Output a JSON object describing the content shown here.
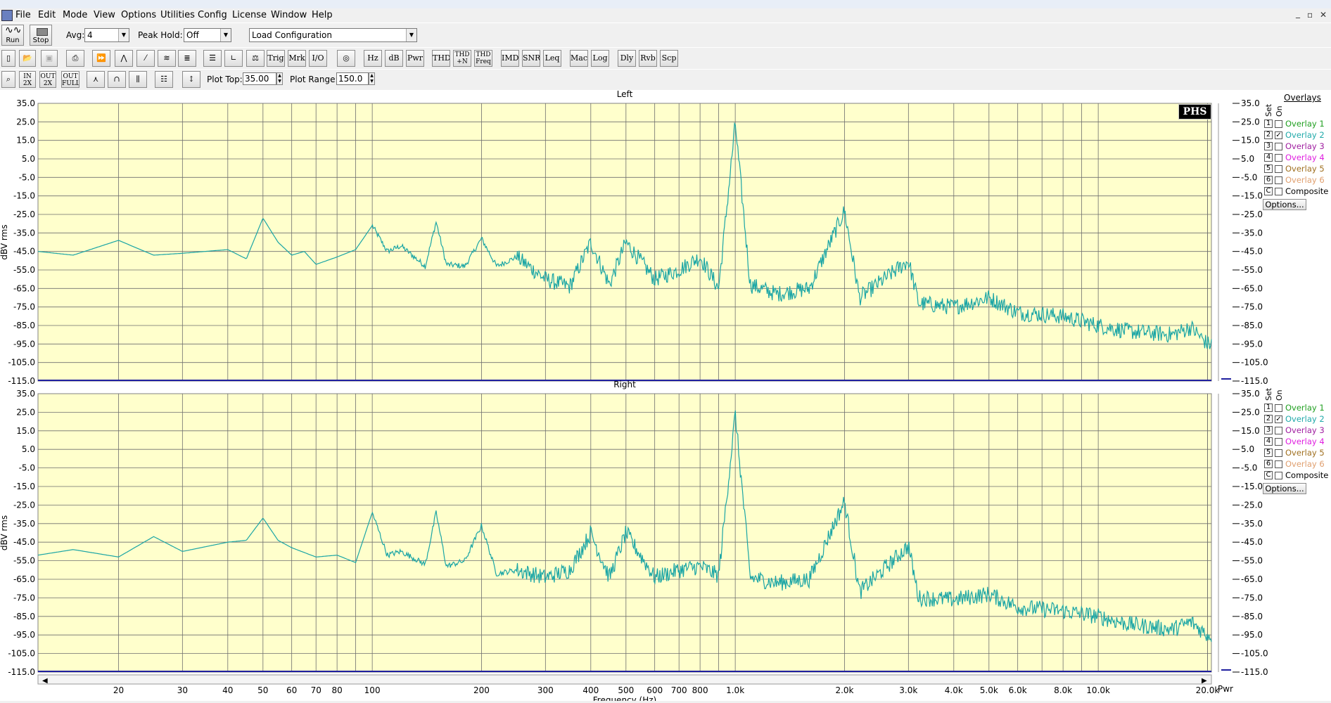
{
  "menu": [
    "File",
    "Edit",
    "Mode",
    "View",
    "Options",
    "Utilities",
    "Config",
    "License",
    "Window",
    "Help"
  ],
  "toolbar1": {
    "run_label": "Run",
    "stop_label": "Stop",
    "avg_label": "Avg:",
    "avg_value": "4",
    "peak_hold_label": "Peak Hold:",
    "peak_hold_value": "Off",
    "config_value": "Load Configuration"
  },
  "toolbar2": {
    "text_buttons": [
      "Trig",
      "Mrk",
      "I/O",
      "Hz",
      "dB",
      "Pwr",
      "THD",
      "THD +N",
      "THD Freq",
      "IMD",
      "SNR",
      "Leq",
      "Mac",
      "Log",
      "Dly",
      "Rvb",
      "Scp"
    ]
  },
  "toolbar3": {
    "zoom_labels": [
      "IN 2X",
      "OUT 2X",
      "OUT FULL"
    ],
    "plot_top_label": "Plot Top:",
    "plot_top_value": "35.00",
    "plot_range_label": "Plot Range:",
    "plot_range_value": "150.0"
  },
  "overlays": {
    "title": "Overlays",
    "set_label": "Set",
    "on_label": "On",
    "items": [
      {
        "num": "1",
        "label": "Overlay 1",
        "color": "#22a022",
        "checked": false
      },
      {
        "num": "2",
        "label": "Overlay 2",
        "color": "#22aaaa",
        "checked": true
      },
      {
        "num": "3",
        "label": "Overlay 3",
        "color": "#a01fa0",
        "checked": false
      },
      {
        "num": "4",
        "label": "Overlay 4",
        "color": "#e020e0",
        "checked": false
      },
      {
        "num": "5",
        "label": "Overlay 5",
        "color": "#a07020",
        "checked": false
      },
      {
        "num": "6",
        "label": "Overlay 6",
        "color": "#e0a070",
        "checked": false
      },
      {
        "num": "C",
        "label": "Composite",
        "color": "#000000",
        "checked": false
      }
    ],
    "options_label": "Options..."
  },
  "logo": "PHS",
  "pwr_label": "Pwr",
  "chart_data": [
    {
      "type": "line",
      "title": "Left",
      "ylabel": "dBV rms",
      "xlabel": "Frequency (Hz)",
      "ylim": [
        -115,
        35
      ],
      "xlim": [
        12,
        20500
      ],
      "xscale": "log",
      "grid": true,
      "yticks": [
        "35.0",
        "25.0",
        "15.0",
        "5.0",
        "-5.0",
        "-15.0",
        "-25.0",
        "-35.0",
        "-45.0",
        "-55.0",
        "-65.0",
        "-75.0",
        "-85.0",
        "-95.0",
        "-105.0",
        "-115.0"
      ],
      "series": [
        {
          "color": "#1aa5a5",
          "points": [
            [
              12,
              -45
            ],
            [
              15,
              -47
            ],
            [
              20,
              -39
            ],
            [
              25,
              -47
            ],
            [
              30,
              -46
            ],
            [
              40,
              -44
            ],
            [
              45,
              -49
            ],
            [
              50,
              -27
            ],
            [
              55,
              -40
            ],
            [
              60,
              -47
            ],
            [
              65,
              -45
            ],
            [
              70,
              -52
            ],
            [
              80,
              -48
            ],
            [
              90,
              -44
            ],
            [
              100,
              -31
            ],
            [
              110,
              -45
            ],
            [
              120,
              -42
            ],
            [
              140,
              -53
            ],
            [
              150,
              -29
            ],
            [
              160,
              -52
            ],
            [
              180,
              -53
            ],
            [
              200,
              -38
            ],
            [
              220,
              -53
            ],
            [
              250,
              -48
            ],
            [
              300,
              -60
            ],
            [
              350,
              -64
            ],
            [
              400,
              -40
            ],
            [
              450,
              -63
            ],
            [
              500,
              -40
            ],
            [
              600,
              -60
            ],
            [
              700,
              -55
            ],
            [
              800,
              -48
            ],
            [
              900,
              -65
            ],
            [
              1000,
              24
            ],
            [
              1100,
              -63
            ],
            [
              1300,
              -68
            ],
            [
              1600,
              -65
            ],
            [
              2000,
              -23
            ],
            [
              2200,
              -70
            ],
            [
              3000,
              -50
            ],
            [
              3200,
              -73
            ],
            [
              4000,
              -75
            ],
            [
              5000,
              -70
            ],
            [
              6000,
              -78
            ],
            [
              8000,
              -80
            ],
            [
              10000,
              -85
            ],
            [
              12000,
              -88
            ],
            [
              16000,
              -90
            ],
            [
              18000,
              -86
            ],
            [
              20000,
              -95
            ]
          ]
        }
      ]
    },
    {
      "type": "line",
      "title": "Right",
      "ylabel": "dBV rms",
      "xlabel": "Frequency (Hz)",
      "ylim": [
        -115,
        35
      ],
      "xlim": [
        12,
        20500
      ],
      "xscale": "log",
      "grid": true,
      "yticks": [
        "35.0",
        "25.0",
        "15.0",
        "5.0",
        "-5.0",
        "-15.0",
        "-25.0",
        "-35.0",
        "-45.0",
        "-55.0",
        "-65.0",
        "-75.0",
        "-85.0",
        "-95.0",
        "-105.0",
        "-115.0"
      ],
      "series": [
        {
          "color": "#1aa5a5",
          "points": [
            [
              12,
              -52
            ],
            [
              15,
              -49
            ],
            [
              20,
              -53
            ],
            [
              25,
              -42
            ],
            [
              30,
              -50
            ],
            [
              40,
              -45
            ],
            [
              45,
              -44
            ],
            [
              50,
              -32
            ],
            [
              55,
              -44
            ],
            [
              60,
              -48
            ],
            [
              70,
              -53
            ],
            [
              80,
              -52
            ],
            [
              90,
              -56
            ],
            [
              100,
              -29
            ],
            [
              110,
              -52
            ],
            [
              120,
              -50
            ],
            [
              140,
              -57
            ],
            [
              150,
              -29
            ],
            [
              160,
              -58
            ],
            [
              180,
              -55
            ],
            [
              200,
              -36
            ],
            [
              220,
              -62
            ],
            [
              250,
              -60
            ],
            [
              300,
              -64
            ],
            [
              350,
              -60
            ],
            [
              400,
              -40
            ],
            [
              450,
              -64
            ],
            [
              500,
              -40
            ],
            [
              600,
              -64
            ],
            [
              700,
              -60
            ],
            [
              800,
              -58
            ],
            [
              900,
              -63
            ],
            [
              1000,
              24
            ],
            [
              1100,
              -64
            ],
            [
              1300,
              -67
            ],
            [
              1600,
              -65
            ],
            [
              2000,
              -23
            ],
            [
              2200,
              -72
            ],
            [
              3000,
              -47
            ],
            [
              3200,
              -75
            ],
            [
              4000,
              -76
            ],
            [
              5000,
              -73
            ],
            [
              6000,
              -80
            ],
            [
              8000,
              -82
            ],
            [
              10000,
              -85
            ],
            [
              12000,
              -89
            ],
            [
              16000,
              -92
            ],
            [
              18000,
              -88
            ],
            [
              20000,
              -95
            ]
          ]
        }
      ]
    }
  ],
  "xticks": [
    {
      "f": 20,
      "label": "20"
    },
    {
      "f": 30,
      "label": "30"
    },
    {
      "f": 40,
      "label": "40"
    },
    {
      "f": 50,
      "label": "50"
    },
    {
      "f": 60,
      "label": "60"
    },
    {
      "f": 70,
      "label": "70"
    },
    {
      "f": 80,
      "label": "80"
    },
    {
      "f": 100,
      "label": "100"
    },
    {
      "f": 200,
      "label": "200"
    },
    {
      "f": 300,
      "label": "300"
    },
    {
      "f": 400,
      "label": "400"
    },
    {
      "f": 500,
      "label": "500"
    },
    {
      "f": 600,
      "label": "600"
    },
    {
      "f": 700,
      "label": "700"
    },
    {
      "f": 800,
      "label": "800"
    },
    {
      "f": 1000,
      "label": "1.0k"
    },
    {
      "f": 2000,
      "label": "2.0k"
    },
    {
      "f": 3000,
      "label": "3.0k"
    },
    {
      "f": 4000,
      "label": "4.0k"
    },
    {
      "f": 5000,
      "label": "5.0k"
    },
    {
      "f": 6000,
      "label": "6.0k"
    },
    {
      "f": 8000,
      "label": "8.0k"
    },
    {
      "f": 10000,
      "label": "10.0k"
    },
    {
      "f": 20000,
      "label": "20.0k"
    }
  ]
}
